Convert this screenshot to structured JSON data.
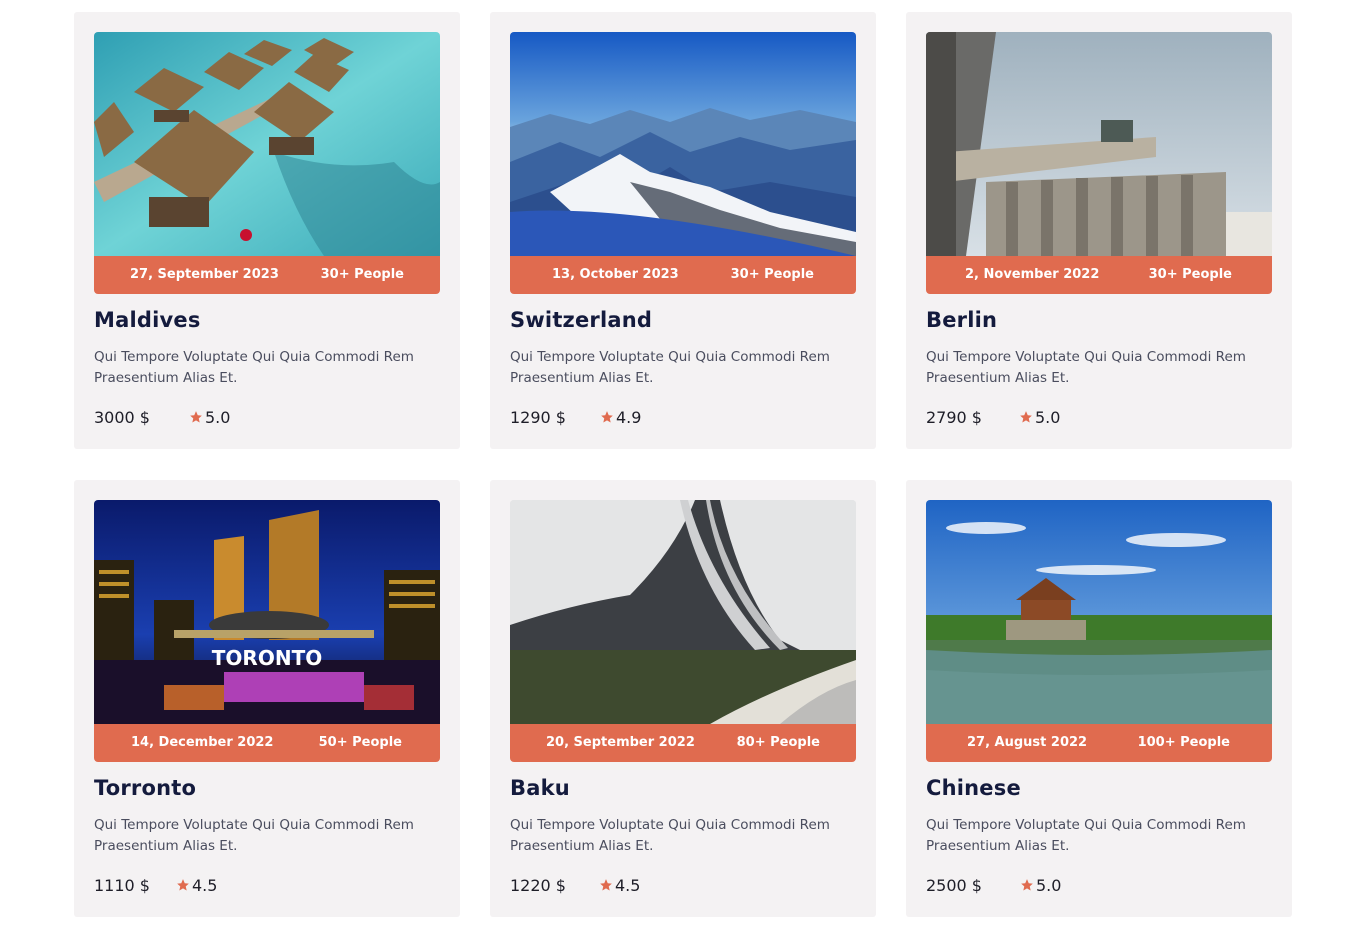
{
  "accent_color": "#e06b4f",
  "title_color": "#141b3d",
  "cards": [
    {
      "title": "Maldives",
      "date": "27, September 2023",
      "people": "30+ People",
      "description": "Qui Tempore Voluptate Qui Quia Commodi Rem Praesentium Alias Et.",
      "price": "3000 $",
      "rating": "5.0",
      "image": "maldives-water-villas"
    },
    {
      "title": "Switzerland",
      "date": "13, October 2023",
      "people": "30+ People",
      "description": "Qui Tempore Voluptate Qui Quia Commodi Rem Praesentium Alias Et.",
      "price": "1290 $",
      "rating": "4.9",
      "image": "swiss-alps-mountains"
    },
    {
      "title": "Berlin",
      "date": "2, November 2022",
      "people": "30+ People",
      "description": "Qui Tempore Voluptate Qui Quia Commodi Rem Praesentium Alias Et.",
      "price": "2790 $",
      "rating": "5.0",
      "image": "brandenburg-gate"
    },
    {
      "title": "Torronto",
      "date": "14, December 2022",
      "people": "50+ People",
      "description": "Qui Tempore Voluptate Qui Quia Commodi Rem Praesentium Alias Et.",
      "price": "1110 $",
      "rating": "4.5",
      "image": "toronto-city-hall-night",
      "image_text": "TORONTO"
    },
    {
      "title": "Baku",
      "date": "20, September 2022",
      "people": "80+ People",
      "description": "Qui Tempore Voluptate Qui Quia Commodi Rem Praesentium Alias Et.",
      "price": "1220 $",
      "rating": "4.5",
      "image": "heydar-aliyev-center"
    },
    {
      "title": "Chinese",
      "date": "27, August 2022",
      "people": "100+ People",
      "description": "Qui Tempore Voluptate Qui Quia Commodi Rem Praesentium Alias Et.",
      "price": "2500 $",
      "rating": "5.0",
      "image": "forbidden-city-moat"
    }
  ]
}
